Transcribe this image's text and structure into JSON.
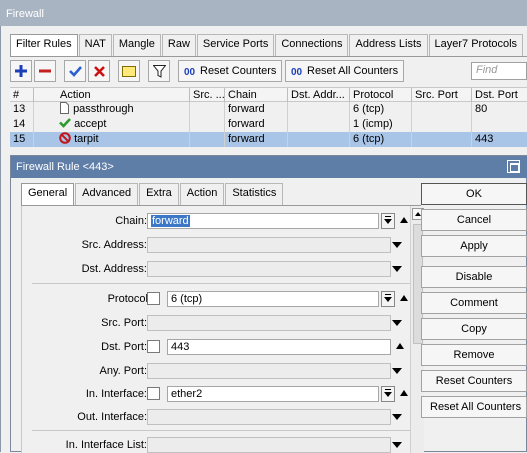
{
  "window": {
    "title": "Firewall"
  },
  "tabs": [
    "Filter Rules",
    "NAT",
    "Mangle",
    "Raw",
    "Service Ports",
    "Connections",
    "Address Lists",
    "Layer7 Protocols"
  ],
  "toolbar": {
    "reset_counters": "Reset Counters",
    "reset_all_counters": "Reset All Counters",
    "find_placeholder": "Find"
  },
  "table": {
    "columns": [
      "#",
      "Action",
      "Src. ...",
      "Chain",
      "Dst. Addr...",
      "Protocol",
      "Src. Port",
      "Dst. Port"
    ],
    "rows": [
      {
        "num": "13",
        "action": "passthrough",
        "chain": "forward",
        "protocol": "6 (tcp)",
        "dst_port": "80"
      },
      {
        "num": "14",
        "action": "accept",
        "chain": "forward",
        "protocol": "1 (icmp)",
        "dst_port": ""
      },
      {
        "num": "15",
        "action": "tarpit",
        "chain": "forward",
        "protocol": "6 (tcp)",
        "dst_port": "443"
      }
    ]
  },
  "dialog": {
    "title": "Firewall Rule <443>",
    "tabs": [
      "General",
      "Advanced",
      "Extra",
      "Action",
      "Statistics"
    ],
    "fields": {
      "chain": {
        "label": "Chain:",
        "value": "forward"
      },
      "src_address": {
        "label": "Src. Address:"
      },
      "dst_address": {
        "label": "Dst. Address:"
      },
      "protocol": {
        "label": "Protocol:",
        "value": "6 (tcp)"
      },
      "src_port": {
        "label": "Src. Port:"
      },
      "dst_port": {
        "label": "Dst. Port:",
        "value": "443"
      },
      "any_port": {
        "label": "Any. Port:"
      },
      "in_interface": {
        "label": "In. Interface:",
        "value": "ether2"
      },
      "out_interface": {
        "label": "Out. Interface:"
      },
      "in_interface_list": {
        "label": "In. Interface List:"
      }
    },
    "buttons": [
      "OK",
      "Cancel",
      "Apply",
      "Disable",
      "Comment",
      "Copy",
      "Remove",
      "Reset Counters",
      "Reset All Counters"
    ]
  },
  "colors": {
    "title_bar": "#a9b4c2",
    "dialog_title_bar": "#5f7ea7",
    "selected_row": "#a8c4e6",
    "add_icon": "#1a3fb8",
    "remove_icon": "#c41e1e",
    "check_icon": "#2a5fd0",
    "cross_icon": "#cc1111"
  }
}
